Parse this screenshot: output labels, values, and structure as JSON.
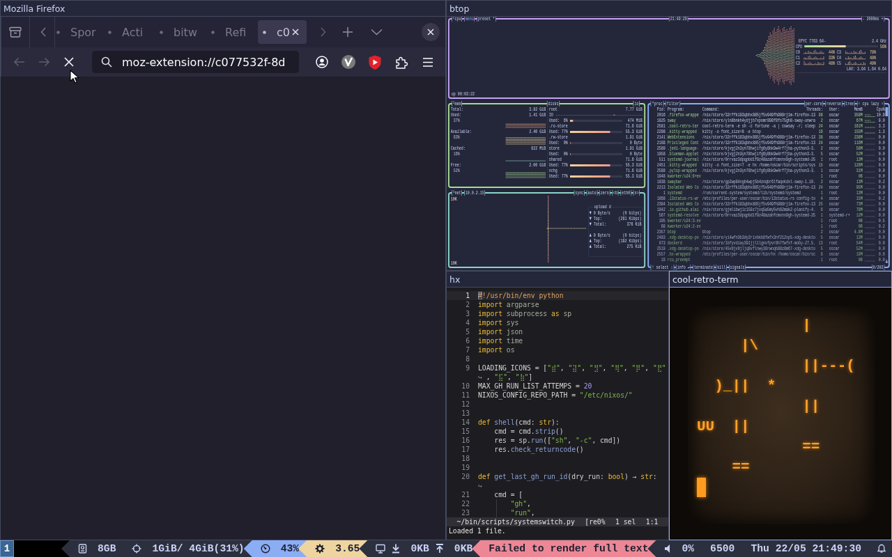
{
  "firefox": {
    "title": "Mozilla Firefox",
    "focused": false,
    "tabs": [
      {
        "label": "Spor",
        "selected": false
      },
      {
        "label": "Acti",
        "selected": false
      },
      {
        "label": "bitw",
        "selected": false
      },
      {
        "label": "Refi",
        "selected": false
      },
      {
        "label": "c0",
        "selected": true
      }
    ],
    "navigation": [
      {
        "kind": "back",
        "disabled": true
      },
      {
        "kind": "forward",
        "disabled": true
      },
      {
        "kind": "stop",
        "disabled": false
      }
    ],
    "address": "moz-extension://c077532f-8d"
  },
  "btop": {
    "title": "btop",
    "focused": false,
    "cpu": {
      "label": "¹cpu",
      "menu": "menu",
      "preset": "preset *",
      "clock": "21:49:29",
      "interval": "- 2000ms +",
      "model": "EPYC 7763 64-",
      "frequency": "2.4 GHz",
      "total": {
        "name": "CPU",
        "level": 0.56,
        "percent": "56%"
      },
      "cores": [
        {
          "name": "C0",
          "percent": "44%"
        },
        {
          "name": "C1",
          "percent": "33%"
        },
        {
          "name": "C2",
          "percent": "48%"
        },
        {
          "name": "C3",
          "percent": "79%"
        },
        {
          "name": "C4",
          "percent": "48%"
        },
        {
          "name": "C5",
          "percent": "49%"
        }
      ],
      "load": "LAV: 3.64 1.64 0.64",
      "uptime": "up 00:03:22"
    },
    "mem": {
      "label": "²mem",
      "total": {
        "name": "Total:",
        "value": "3.82 GiB"
      },
      "meters": [
        {
          "name": "Used:",
          "value": "1.41 GiB",
          "percent": "37%"
        },
        {
          "name": "Available:",
          "value": "2.40 GiB",
          "percent": "63%"
        },
        {
          "name": "Cached:",
          "value": "622 MiB",
          "percent": "16%"
        },
        {
          "name": "Free:",
          "value": "2.00 GiB",
          "percent": "52%"
        }
      ]
    },
    "disks": {
      "label": "disks",
      "io_label": "io",
      "items": [
        {
          "name": "root",
          "size": "7.77 GiB",
          "io": "IO",
          "used_label": "Used:",
          "percent": "6%",
          "level": 0.06,
          "used": "474 MiB"
        },
        {
          "name": ".ro-store",
          "size": "71.6 GiB",
          "used_label": "Used:",
          "percent": "77%",
          "level": 0.77,
          "used": "55.3 GiB"
        },
        {
          "name": ".rw-store",
          "size": "1.91 GiB",
          "used_label": "Used:",
          "percent": "0%",
          "level": 0,
          "used": "0 Byte"
        },
        {
          "name": "store",
          "size": "1.91 GiB",
          "used_label": "Used:",
          "percent": "0%",
          "level": 0,
          "used": "0 Byte"
        },
        {
          "name": "shared",
          "size": "71.6 GiB",
          "used_label": "Used:",
          "percent": "77%",
          "level": 0.77,
          "used": "55.3 GiB"
        },
        {
          "name": "xchg",
          "size": "71.6 GiB",
          "used_label": "Used:",
          "percent": "77%",
          "level": 0.77,
          "used": "55.3 GiB"
        }
      ]
    },
    "net": {
      "label": "³net",
      "address": "10.0.2.15",
      "options": [
        "sync",
        "auto",
        "zero",
        "<b",
        "eth0",
        "n>"
      ],
      "scale_top": "10K",
      "scale_bottom": "10K",
      "stats_title": "upload d",
      "download": [
        {
          "label": "▼ 0 Byte/s",
          "value": "(0 bitps)"
        },
        {
          "label": "▼ Top:",
          "value": "(261 Kibps)"
        },
        {
          "label": "▼ Total:",
          "value": "376 KiB"
        }
      ],
      "upload": [
        {
          "label": "▲ 0 Byte/s",
          "value": "(0 bitps)"
        },
        {
          "label": "▲ Top:",
          "value": "(192 Kibps)"
        },
        {
          "label": "▲ Total:",
          "value": "275 KiB"
        }
      ]
    },
    "proc": {
      "label": "⁴proc",
      "filter": "filter",
      "options": [
        "per-core",
        "reverse",
        "tree",
        "‹ cpu lazy ›"
      ],
      "columns": {
        "pid": "Pid:",
        "program": "Program:",
        "command": "Command:",
        "threads": "Threads:",
        "user": "User:",
        "mem": "MemB",
        "cpu": "Cpu%"
      },
      "rows": [
        {
          "pid": "2016",
          "program": ".firefox-wrappe",
          "command": "/nix/store/32rffk183qbhx885jf5v949fh988rj1m-firefox-13",
          "threads": "98",
          "user": "oscar",
          "mem": "358M",
          "cpu": "10.9"
        },
        {
          "pid": "1825",
          "program": "sway",
          "command": "/nix/store/yln8bnkh4ydjjb7xpomr898f8fs75gh8-sway-unwra",
          "threads": "2",
          "user": "oscar",
          "mem": "67M",
          "cpu": "9.0"
        },
        {
          "pid": "2581",
          "program": ".cool-retro-ter",
          "command": "cool-retro-term -e sh -c fortune -a | cowsay -r; sleep",
          "threads": "24",
          "user": "oscar",
          "mem": "161M",
          "cpu": "3.3"
        },
        {
          "pid": "2298",
          "program": ".kitty-wrapped",
          "command": "kitty -o font_size=8 -e btop",
          "threads": "16",
          "user": "oscar",
          "mem": "155M",
          "cpu": "1.3"
        },
        {
          "pid": "2141",
          "program": "WebExtensions",
          "command": "/nix/store/32rffk183qbhx885jf5v949fh988rj1m-firefox-13",
          "threads": "38",
          "user": "oscar",
          "mem": "238M",
          "cpu": "0.0"
        },
        {
          "pid": "2188",
          "program": "Privileged Cont",
          "command": "/nix/store/32rffk183qbhx885jf5v949fh988rj1m-firefox-13",
          "threads": "24",
          "user": "oscar",
          "mem": "116M",
          "cpu": "0.0"
        },
        {
          "pid": "2589",
          "program": ".jedi-language-",
          "command": "/nix/store/kjvgj2n3yn78hwjifg6y8bk9w4rf7jba-python3-3.",
          "threads": "2",
          "user": "oscar",
          "mem": "58M",
          "cpu": "0.0"
        },
        {
          "pid": "1858",
          "program": ".blueman-applet",
          "command": "/nix/store/kjvgj2n3yn78hwjifg6y8bk9w4rf7jba-python3-3.",
          "threads": "5",
          "user": "oscar",
          "mem": "52M",
          "cpu": "0.0"
        },
        {
          "pid": "511",
          "program": "systemd-journal",
          "command": "/nix/store/0rrvaz3dpqpbd1f9z48azahfcmxnx9gh-systemd-25",
          "threads": "1",
          "user": "root",
          "mem": "13M",
          "cpu": "0.0"
        },
        {
          "pid": "2451",
          "program": ".kitty-wrapped",
          "command": "kitty -o font_size=7 -e hx /home/oscar/bin/scripts/sys",
          "threads": "15",
          "user": "oscar",
          "mem": "128M",
          "cpu": "0.0"
        },
        {
          "pid": "2588",
          "program": ".pylsp-wrapped",
          "command": "/nix/store/kjvgj2n3yn78hwjifg6y8bk9w4rf7jba-python3-3.",
          "threads": "1",
          "user": "oscar",
          "mem": "31M",
          "cpu": "0.0"
        },
        {
          "pid": "1948",
          "program": "kworker/u24:6+ev",
          "threads": "1",
          "user": "root",
          "mem": "0B",
          "cpu": "0.0"
        },
        {
          "pid": "1838",
          "program": "swaybar",
          "command": "/nix/store/gp2wp84xgb4wpj5b4znqbr6lfaqvkdxl-sway-1.10.",
          "threads": "2",
          "user": "oscar",
          "mem": "13M",
          "cpu": "0.2"
        },
        {
          "pid": "2213",
          "program": "Isolated Web Co",
          "command": "/nix/store/32rffk183qbhx885jf5v949fh988rj1m-firefox-13",
          "threads": "24",
          "user": "oscar",
          "mem": "95M",
          "cpu": "0.0"
        },
        {
          "pid": "1",
          "program": "systemd",
          "command": "/run/current-system/systemd/lib/systemd/systemd",
          "threads": "1",
          "user": "root",
          "mem": "13M",
          "cpu": "0.0"
        },
        {
          "pid": "1868",
          "program": ".i3status-rs-wr",
          "command": "/etc/profiles/per-user/oscar/bin/i3status-rs config-to",
          "threads": "4",
          "user": "oscar",
          "mem": "15M",
          "cpu": "0.2"
        },
        {
          "pid": "2384",
          "program": "Isolated Web Co",
          "command": "/nix/store/32rffk183qbhx885jf5v949fh988rj1m-firefox-13",
          "threads": "25",
          "user": "oscar",
          "mem": "73M",
          "cpu": "0.0"
        },
        {
          "pid": "1842",
          "program": ".io.github.alai",
          "command": "/nix/store/gjmlibwj1c159z7jvq5a5my5vh82mak2-planify-4.",
          "threads": "6",
          "user": "oscar",
          "mem": "78M",
          "cpu": "0.0"
        },
        {
          "pid": "567",
          "program": "systemd-resolve",
          "command": "/nix/store/0rrvaz3dpqpbd1f9z48azahfcmxnx9gh-systemd-25",
          "threads": "1",
          "user": "systemd-r+",
          "mem": "12M",
          "cpu": "0.0"
        },
        {
          "pid": "195",
          "program": "kworker/u24:3-ev",
          "threads": "1",
          "user": "root",
          "mem": "0B",
          "cpu": "0.5"
        },
        {
          "pid": "68",
          "program": "kworker/u24:2-ex",
          "threads": "1",
          "user": "root",
          "mem": "0B",
          "cpu": "0.2"
        },
        {
          "pid": "2357",
          "program": "btop",
          "command": "btop",
          "threads": "2",
          "user": "oscar",
          "mem": "4.8M",
          "cpu": "0.0"
        },
        {
          "pid": "2483",
          "program": ".xdg-desktop-po",
          "command": "/nix/store/yi4wfn3b3dy2rixbkb8fwfx3nf212xp5-xdg-deskto",
          "threads": "5",
          "user": "oscar",
          "mem": "13M",
          "cpu": "0.0"
        },
        {
          "pid": "973",
          "program": "dockerd",
          "command": "/nix/store/1bfyvdiay391jjl1lgnvfpvr8h7fwfxf-moby-27.5.",
          "threads": "13",
          "user": "root",
          "mem": "54M",
          "cpu": "0.0"
        },
        {
          "pid": "2519",
          "program": ".xdg-desktop-po",
          "command": "/nix/store/45v8jv8jljq8vflnwy38rwnqb88z8m67-xdg-deskto",
          "threads": "5",
          "user": "oscar",
          "mem": "52M",
          "cpu": "0.0"
        },
        {
          "pid": "2557",
          "program": ".hx-wrapped",
          "command": "/etc/profiles/per-user/oscar/bin/hx /home/oscar/bin/sc",
          "threads": "8",
          "user": "oscar",
          "mem": "19M",
          "cpu": "0.0"
        },
        {
          "pid": "19",
          "program": "rcu_preempt",
          "threads": "1",
          "user": "root",
          "mem": "0B",
          "cpu": "0.0"
        }
      ],
      "footer": [
        "↑ select ↓",
        "info ↵",
        "terminate",
        "kill",
        "signals"
      ],
      "count": "0/202"
    }
  },
  "editor": {
    "title": "hx",
    "focused": false,
    "lines": [
      {
        "number": "1",
        "current": true,
        "tokens": [
          {
            "kind": "comment",
            "text": "#!/usr/bin/env python"
          }
        ]
      },
      {
        "number": "2",
        "current": false,
        "tokens": [
          {
            "kind": "keyword",
            "text": "import"
          },
          {
            "kind": "module",
            "text": " argparse"
          }
        ]
      },
      {
        "number": "3",
        "current": false,
        "tokens": [
          {
            "kind": "keyword",
            "text": "import"
          },
          {
            "kind": "module",
            "text": " subprocess"
          },
          {
            "kind": "keyword",
            "text": " as"
          },
          {
            "kind": "module",
            "text": " sp"
          }
        ]
      },
      {
        "number": "4",
        "current": false,
        "tokens": [
          {
            "kind": "keyword",
            "text": "import"
          },
          {
            "kind": "module",
            "text": " sys"
          }
        ]
      },
      {
        "number": "5",
        "current": false,
        "tokens": [
          {
            "kind": "keyword",
            "text": "import"
          },
          {
            "kind": "module",
            "text": " json"
          }
        ]
      },
      {
        "number": "6",
        "current": false,
        "tokens": [
          {
            "kind": "keyword",
            "text": "import"
          },
          {
            "kind": "module",
            "text": " time"
          }
        ]
      },
      {
        "number": "7",
        "current": false,
        "tokens": [
          {
            "kind": "keyword",
            "text": "import"
          },
          {
            "kind": "module",
            "text": " os"
          }
        ]
      },
      {
        "number": "8",
        "current": false
      },
      {
        "number": "9",
        "current": false,
        "tokens": [
          {
            "kind": "plain",
            "text": "LOADING_ICONS = ["
          },
          {
            "kind": "string",
            "text": "\"⣾\""
          },
          {
            "kind": "plain",
            "text": ", "
          },
          {
            "kind": "string",
            "text": "\"⣽\""
          },
          {
            "kind": "plain",
            "text": ", "
          },
          {
            "kind": "string",
            "text": "\"⣻\""
          },
          {
            "kind": "plain",
            "text": ", "
          },
          {
            "kind": "string",
            "text": "\"⢿\""
          },
          {
            "kind": "plain",
            "text": ", "
          },
          {
            "kind": "string",
            "text": "\"⡿\""
          },
          {
            "kind": "plain",
            "text": ", "
          },
          {
            "kind": "string",
            "text": "\"⣟\""
          }
        ],
        "wrap": {
          "marker": "↪",
          "tokens": [
            {
              "kind": "plain",
              "text": ", "
            },
            {
              "kind": "string",
              "text": "\"⣯\""
            },
            {
              "kind": "plain",
              "text": ", "
            },
            {
              "kind": "string",
              "text": "\"⣷\""
            },
            {
              "kind": "plain",
              "text": "]"
            }
          ]
        }
      },
      {
        "number": "10",
        "current": false,
        "tokens": [
          {
            "kind": "plain",
            "text": "MAX_GH_RUN_LIST_ATTEMPS = "
          },
          {
            "kind": "number",
            "text": "20"
          }
        ]
      },
      {
        "number": "11",
        "current": false,
        "tokens": [
          {
            "kind": "plain",
            "text": "NIXOS_CONFIG_REPO_PATH = "
          },
          {
            "kind": "string",
            "text": "\"/etc/nixos/\""
          }
        ]
      },
      {
        "number": "12",
        "current": false
      },
      {
        "number": "13",
        "current": false
      },
      {
        "number": "14",
        "current": false,
        "tokens": [
          {
            "kind": "keyword",
            "text": "def"
          },
          {
            "kind": "function",
            "text": " shell"
          },
          {
            "kind": "plain",
            "text": "(cmd: "
          },
          {
            "kind": "type",
            "text": "str"
          },
          {
            "kind": "plain",
            "text": "):"
          }
        ]
      },
      {
        "number": "15",
        "current": false,
        "tokens": [
          {
            "kind": "plain",
            "text": "    cmd = cmd."
          },
          {
            "kind": "function",
            "text": "strip"
          },
          {
            "kind": "plain",
            "text": "()"
          }
        ]
      },
      {
        "number": "16",
        "current": false,
        "tokens": [
          {
            "kind": "plain",
            "text": "    res = sp."
          },
          {
            "kind": "function",
            "text": "run"
          },
          {
            "kind": "plain",
            "text": "(["
          },
          {
            "kind": "string",
            "text": "\"sh\""
          },
          {
            "kind": "plain",
            "text": ", "
          },
          {
            "kind": "string",
            "text": "\"-c\""
          },
          {
            "kind": "plain",
            "text": ", cmd])"
          }
        ]
      },
      {
        "number": "17",
        "current": false,
        "tokens": [
          {
            "kind": "plain",
            "text": "    res."
          },
          {
            "kind": "function",
            "text": "check_returncode"
          },
          {
            "kind": "plain",
            "text": "()"
          }
        ]
      },
      {
        "number": "18",
        "current": false
      },
      {
        "number": "19",
        "current": false
      },
      {
        "number": "20",
        "current": false,
        "tokens": [
          {
            "kind": "keyword",
            "text": "def"
          },
          {
            "kind": "function",
            "text": " get_last_gh_run_id"
          },
          {
            "kind": "plain",
            "text": "(dry_run: "
          },
          {
            "kind": "type",
            "text": "bool"
          },
          {
            "kind": "plain",
            "text": ") → "
          },
          {
            "kind": "type",
            "text": "str"
          },
          {
            "kind": "plain",
            "text": ":"
          }
        ],
        "wrap": {
          "marker": "↪"
        }
      },
      {
        "number": "21",
        "current": false,
        "tokens": [
          {
            "kind": "plain",
            "text": "    cmd = ["
          }
        ]
      },
      {
        "number": "22",
        "current": false,
        "tokens": [
          {
            "kind": "string",
            "text": "        \"gh\""
          },
          {
            "kind": "plain",
            "text": ","
          }
        ]
      },
      {
        "number": "23",
        "current": false,
        "tokens": [
          {
            "kind": "string",
            "text": "        \"run\""
          },
          {
            "kind": "plain",
            "text": ","
          }
        ]
      }
    ],
    "status": {
      "path": "~/bin/scripts/systemswitch.py",
      "indicator": "[re0%",
      "selections": "1 sel",
      "position": "1:1"
    },
    "message": "Loaded 1 file."
  },
  "terminal": {
    "title": "cool-retro-term",
    "focused": true,
    "lines": [
      "            |",
      "     |\\",
      "            ||---(",
      "  )_||  *",
      "            ||",
      "UU  ||",
      "            ==",
      "    =="
    ]
  },
  "status_bar": {
    "workspaces": [
      {
        "label": "1",
        "selected": true
      }
    ],
    "blocks": [
      {
        "kind": "disk",
        "color": "#2c2f3d",
        "texts": [
          "8GB"
        ]
      },
      {
        "kind": "memory",
        "color": "#2c2f3d",
        "texts": [
          "1GiB/ 4GiB(31%)"
        ]
      },
      {
        "kind": "cpu",
        "color": "#8aadf4",
        "texts": [
          "43%"
        ]
      },
      {
        "kind": "load",
        "color": "#eed49f",
        "texts": [
          "3.65"
        ]
      },
      {
        "kind": "net",
        "color": "#2c2f3d",
        "texts": [
          "0KB",
          "0KB"
        ]
      },
      {
        "kind": "error",
        "color": "#ed8796",
        "texts": [
          "Failed to render full text"
        ]
      },
      {
        "kind": "sound",
        "color": "#2c2f3d",
        "texts": [
          "0%"
        ]
      },
      {
        "kind": "hueshift",
        "color": "#2c2f3d",
        "texts": [
          "6500"
        ]
      },
      {
        "kind": "time",
        "color": "#2c2f3d",
        "texts": [
          "Thu 22/05 21:49:30"
        ]
      },
      {
        "kind": "notify",
        "color": "#2c2f3d"
      }
    ]
  }
}
